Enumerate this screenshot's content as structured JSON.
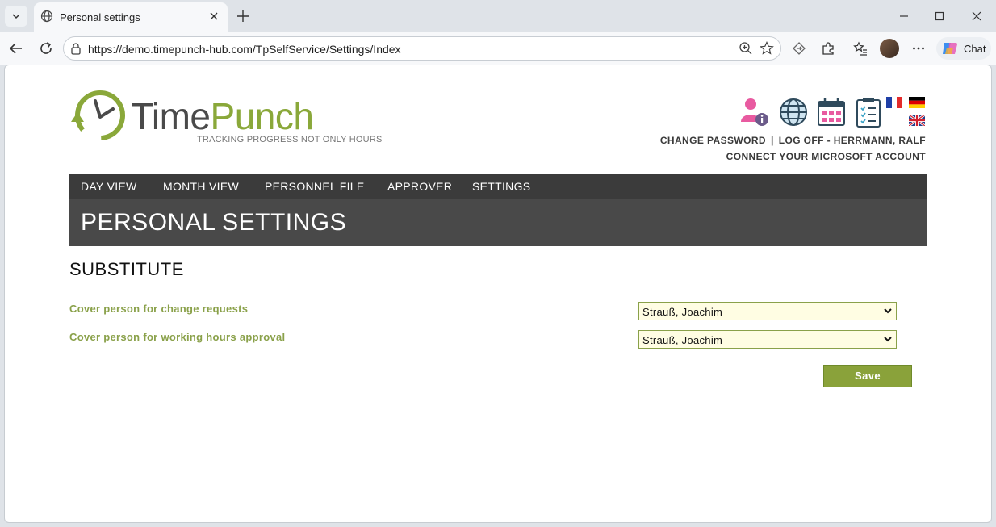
{
  "browser": {
    "tab_title": "Personal settings",
    "url_scheme": "https://",
    "url_host": "demo.timepunch-hub.com",
    "url_path": "/TpSelfService/Settings/Index",
    "chat_label": "Chat"
  },
  "brand": {
    "name_part1": "Time",
    "name_part2": "Punch",
    "tagline": "TRACKING PROGRESS NOT ONLY HOURS",
    "accent": "#8aa83a"
  },
  "header_links": {
    "change_password": "CHANGE PASSWORD",
    "separator": "|",
    "log_off": "LOG OFF - HERRMANN, RALF",
    "connect_ms": "CONNECT YOUR MICROSOFT ACCOUNT"
  },
  "header_icons": [
    "user-info-icon",
    "globe-icon",
    "calendar-icon",
    "clipboard-icon"
  ],
  "languages": [
    "french-flag-icon",
    "german-flag-icon",
    "uk-flag-icon"
  ],
  "nav": {
    "items": [
      "DAY VIEW",
      "MONTH VIEW",
      "PERSONNEL FILE",
      "APPROVER",
      "SETTINGS"
    ]
  },
  "page": {
    "title": "PERSONAL SETTINGS",
    "section": "SUBSTITUTE"
  },
  "form": {
    "change_requests_label": "Cover person for change requests",
    "change_requests_value": "Strauß, Joachim",
    "approval_label": "Cover person for working hours approval",
    "approval_value": "Strauß, Joachim",
    "save_label": "Save"
  }
}
